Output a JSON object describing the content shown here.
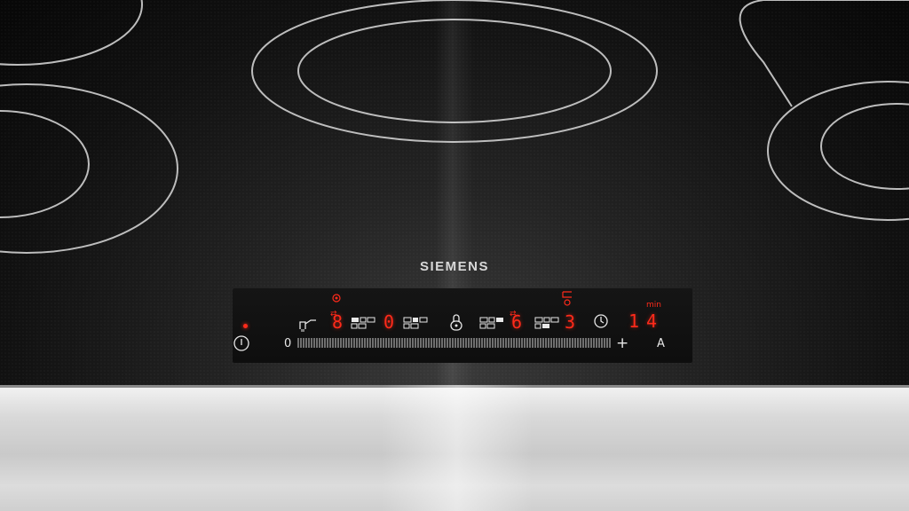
{
  "brand": "SIEMENS",
  "controls": {
    "zone1_level": "8",
    "zone2_level": "0",
    "zone3_level": "6",
    "zone4_level": "3",
    "timer_unit": "min",
    "timer_value": "14",
    "slider_min": "0",
    "slider_plus": "+",
    "auto_label": "A"
  },
  "icons": [
    "power-icon",
    "wipe-protection-icon",
    "child-lock-icon",
    "timer-clock-icon",
    "boost-icon",
    "keep-warm-icon"
  ],
  "colors": {
    "display_red": "#ff2a1a",
    "glass": "#111111",
    "steel": "#d6d6d6"
  }
}
